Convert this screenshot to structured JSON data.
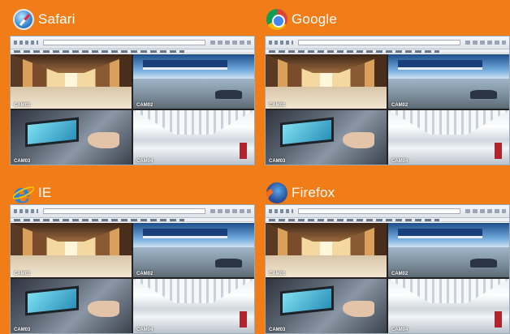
{
  "quadrants": [
    {
      "browser": "Safari",
      "logo": "safari-logo-icon",
      "cams": [
        "CAM01",
        "CAM02",
        "CAM03",
        "CAM04"
      ]
    },
    {
      "browser": "Google",
      "logo": "chrome-logo-icon",
      "cams": [
        "CAM01",
        "CAM02",
        "CAM03",
        "CAM04"
      ]
    },
    {
      "browser": "IE",
      "logo": "internet-explorer-logo-icon",
      "cams": [
        "CAM01",
        "CAM02",
        "CAM03",
        "CAM04"
      ]
    },
    {
      "browser": "Firefox",
      "logo": "firefox-logo-icon",
      "cams": [
        "CAM01",
        "CAM02",
        "CAM03",
        "CAM04"
      ]
    }
  ],
  "colors": {
    "background": "#f07d18",
    "label_text": "#ffffff"
  }
}
